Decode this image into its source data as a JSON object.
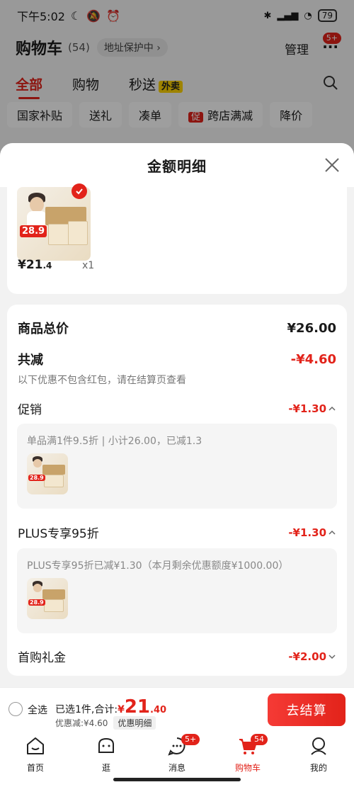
{
  "status_bar": {
    "time": "下午5:02",
    "battery": "79"
  },
  "header": {
    "title": "购物车",
    "count": "(54)",
    "address_protect": "地址保护中",
    "manage": "管理",
    "more_badge": "5+"
  },
  "tabs": [
    {
      "label": "全部"
    },
    {
      "label": "购物"
    },
    {
      "label": "秒送",
      "tag": "外卖"
    }
  ],
  "chips": [
    "国家补贴",
    "送礼",
    "凑单",
    "跨店满减",
    "降价"
  ],
  "chip_promo_tag": "促",
  "sheet": {
    "title": "金额明细",
    "item": {
      "price_int": "¥21",
      "price_dec": ".4",
      "qty": "x1",
      "image_price": "28.9"
    },
    "total_label": "商品总价",
    "total_value": "¥26.00",
    "reduce_label": "共减",
    "reduce_value": "-¥4.60",
    "reduce_note": "以下优惠不包含红包，请在结算页查看",
    "promo_label": "促销",
    "promo_value": "-¥1.30",
    "promo_detail": "单品满1件9.5折 | 小计26.00，已减1.3",
    "plus_label": "PLUS专享95折",
    "plus_value": "-¥1.30",
    "plus_detail": "PLUS专享95折已减¥1.30（本月剩余优惠额度¥1000.00）",
    "first_label": "首购礼金",
    "first_value": "-¥2.00"
  },
  "checkout": {
    "select_all": "全选",
    "selected_prefix": "已选1件,合计:",
    "total_currency": "¥",
    "total_int": "21",
    "total_dec": ".40",
    "discount": "优惠减:¥4.60",
    "detail_button": "优惠明细",
    "checkout_button": "去结算"
  },
  "tab_bar": [
    {
      "label": "首页",
      "icon": "home-icon"
    },
    {
      "label": "逛",
      "icon": "explore-icon"
    },
    {
      "label": "消息",
      "icon": "message-icon",
      "badge": "5+"
    },
    {
      "label": "购物车",
      "icon": "cart-icon",
      "badge": "54"
    },
    {
      "label": "我的",
      "icon": "profile-icon"
    }
  ],
  "colors": {
    "accent": "#e2231a",
    "tag_yellow": "#ffd400"
  }
}
